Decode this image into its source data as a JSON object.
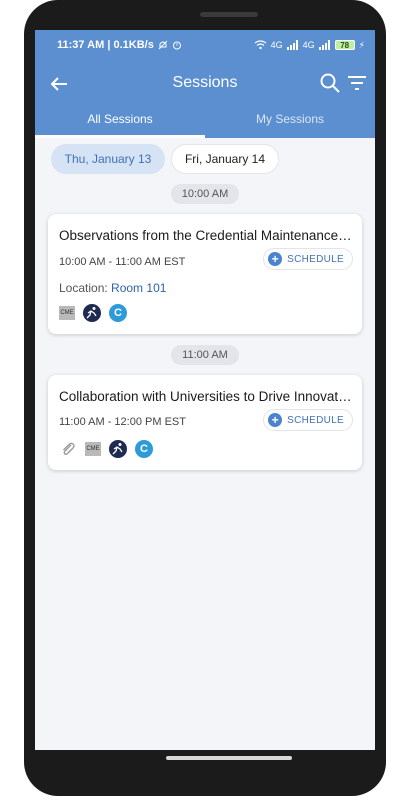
{
  "status_bar": {
    "time_info": "11:37 AM | 0.1KB/s",
    "network_left": "4G",
    "network_right": "4G",
    "battery": "78"
  },
  "app_bar": {
    "title": "Sessions",
    "back_icon": "arrow-left-icon",
    "search_icon": "search-icon",
    "filter_icon": "filter-icon"
  },
  "tabs": [
    {
      "label": "All Sessions",
      "active": true
    },
    {
      "label": "My Sessions",
      "active": false
    }
  ],
  "dates": [
    {
      "label": "Thu, January 13",
      "active": true
    },
    {
      "label": "Fri, January 14",
      "active": false
    }
  ],
  "time_slots": [
    "10:00 AM",
    "11:00 AM"
  ],
  "sessions": [
    {
      "title": "Observations from the Credential Maintenance Program",
      "time": "10:00 AM - 11:00 AM EST",
      "schedule_label": "SCHEDULE",
      "location_label": "Location:",
      "location_value": "Room 101",
      "badges": [
        "CME",
        "runner",
        "C"
      ]
    },
    {
      "title": "Collaboration with Universities to Drive Innovation",
      "time": "11:00 AM - 12:00 PM EST",
      "schedule_label": "SCHEDULE",
      "badges": [
        "attachment",
        "CME",
        "runner",
        "C"
      ]
    }
  ],
  "colors": {
    "primary": "#5b8fd0",
    "accent": "#3d72b8",
    "background": "#f4f5f9"
  }
}
